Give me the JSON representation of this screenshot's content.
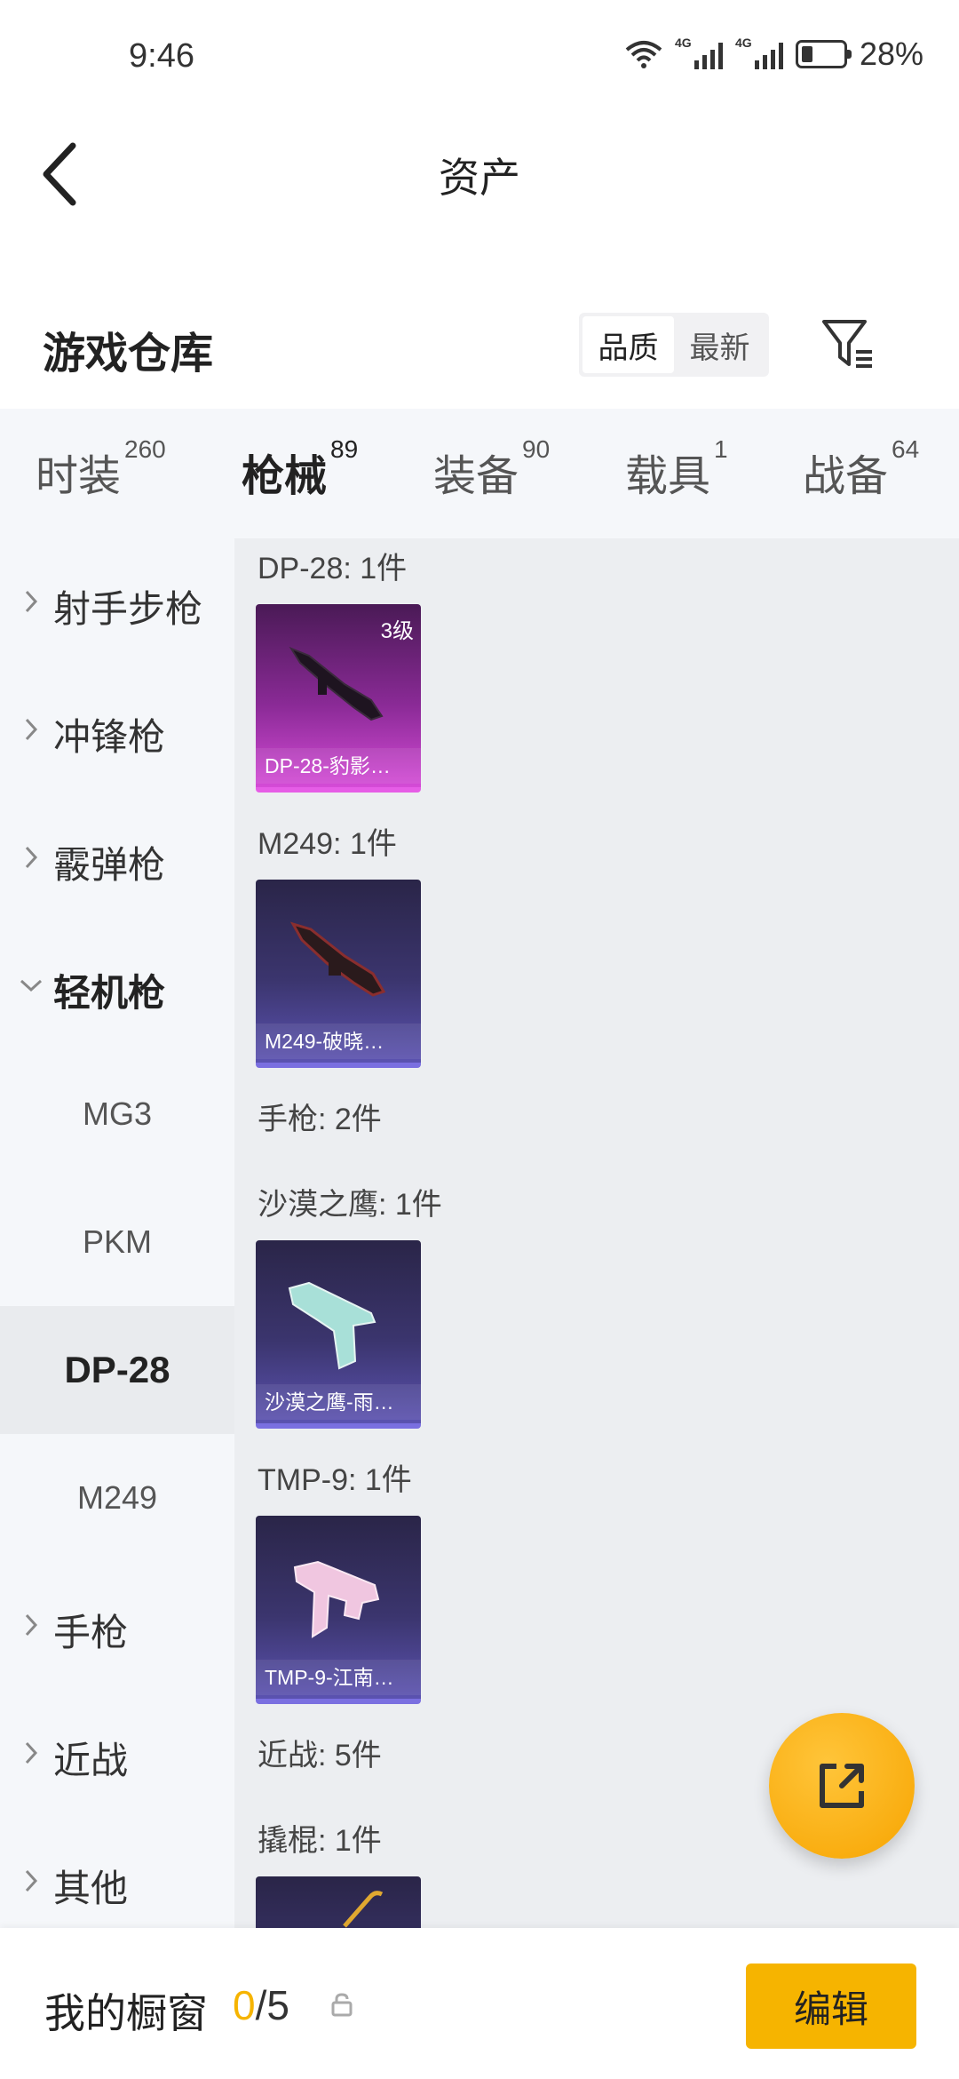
{
  "status": {
    "time": "9:46",
    "net1": "4G",
    "net2": "4G",
    "battery": "28%",
    "battery_level": 0.28
  },
  "header": {
    "title": "资产"
  },
  "section": {
    "title": "游戏仓库",
    "sort_quality": "品质",
    "sort_newest": "最新"
  },
  "tabs": [
    {
      "label": "时装",
      "count": "260"
    },
    {
      "label": "枪械",
      "count": "89"
    },
    {
      "label": "装备",
      "count": "90"
    },
    {
      "label": "载具",
      "count": "1"
    },
    {
      "label": "战备",
      "count": "64"
    }
  ],
  "sidebar": {
    "categories": [
      "射手步枪",
      "冲锋枪",
      "霰弹枪",
      "轻机枪",
      "手枪",
      "近战",
      "其他"
    ],
    "subitems": [
      "MG3",
      "PKM",
      "DP-28",
      "M249"
    ]
  },
  "content": {
    "groups": [
      "DP-28: 1件",
      "M249: 1件",
      "手枪: 2件",
      "沙漠之鹰: 1件",
      "TMP-9: 1件",
      "近战: 5件",
      "撬棍: 1件"
    ],
    "cards": [
      {
        "name": "DP-28-豹影…",
        "level": "3级"
      },
      {
        "name": "M249-破晓…"
      },
      {
        "name": "沙漠之鹰-雨…"
      },
      {
        "name": "TMP-9-江南…"
      }
    ]
  },
  "bottom": {
    "label": "我的橱窗",
    "current": "0",
    "total": "/5",
    "edit": "编辑"
  },
  "colors": {
    "accent": "#f6b400",
    "purple_card": "#c040c8",
    "blue_card": "#5b52b0"
  }
}
